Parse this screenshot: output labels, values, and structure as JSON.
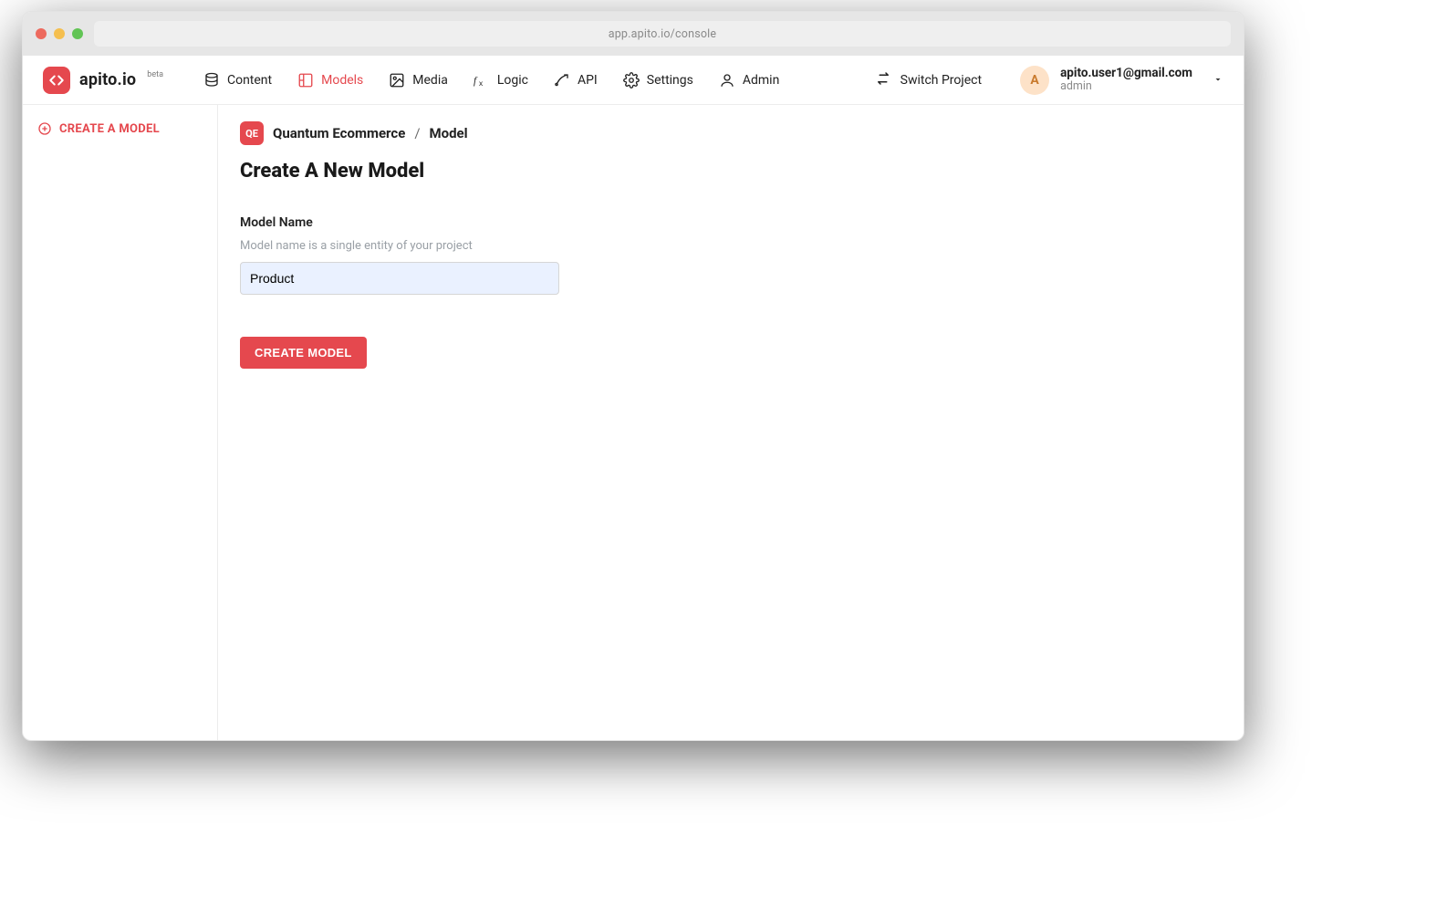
{
  "browser": {
    "address": "app.apito.io/console"
  },
  "brand": {
    "name": "apito.io",
    "beta": "beta"
  },
  "nav": {
    "content": "Content",
    "models": "Models",
    "media": "Media",
    "logic": "Logic",
    "api": "API",
    "settings": "Settings",
    "admin": "Admin",
    "switch_project": "Switch Project"
  },
  "user": {
    "avatar_initial": "A",
    "email": "apito.user1@gmail.com",
    "role": "admin"
  },
  "sidebar": {
    "create_model_label": "CREATE A MODEL"
  },
  "breadcrumb": {
    "project_chip": "QE",
    "project_name": "Quantum Ecommerce",
    "separator": "/",
    "model": "Model"
  },
  "page": {
    "title": "Create A New Model"
  },
  "form": {
    "label": "Model Name",
    "help": "Model name is a single entity of your project",
    "value": "Product",
    "submit_label": "CREATE MODEL"
  }
}
